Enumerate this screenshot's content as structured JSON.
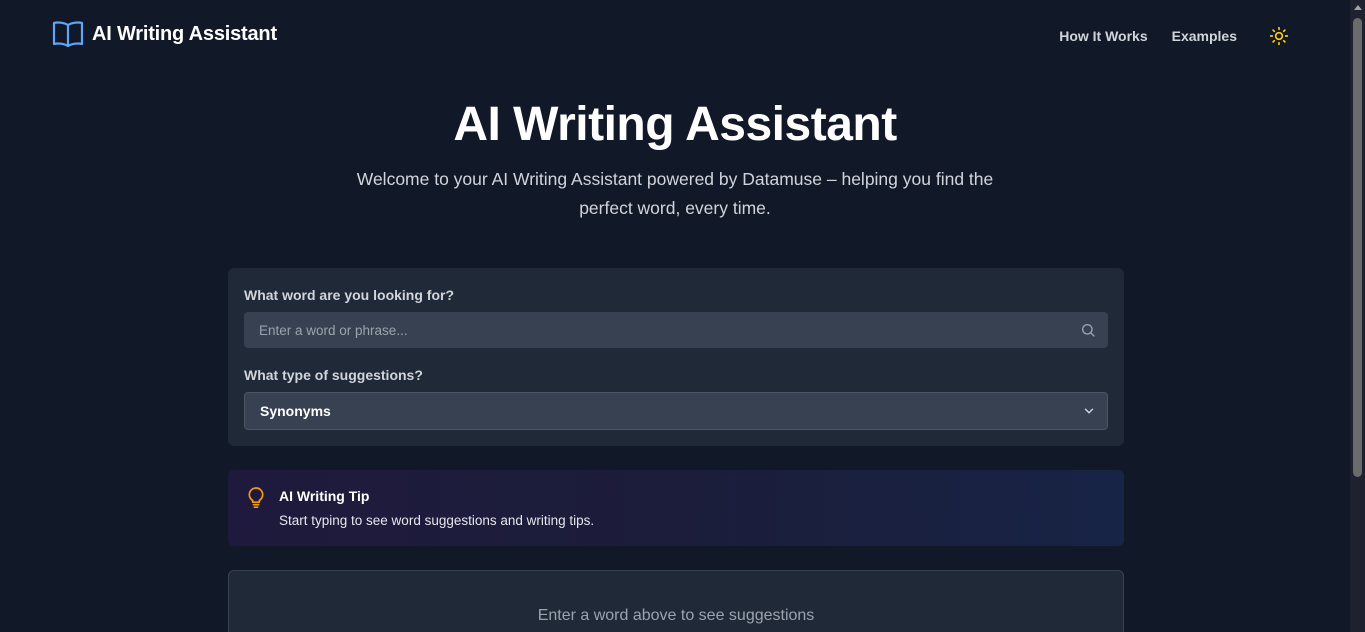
{
  "header": {
    "brand": "AI Writing Assistant",
    "brand_icon": "open-book-icon",
    "nav": [
      "How It Works",
      "Examples"
    ],
    "theme_icon": "sun-icon"
  },
  "hero": {
    "title": "AI Writing Assistant",
    "subtitle": "Welcome to your AI Writing Assistant powered by Datamuse – helping you find the perfect word, every time."
  },
  "search": {
    "word_label": "What word are you looking for?",
    "placeholder": "Enter a word or phrase...",
    "value": "",
    "type_label": "What type of suggestions?",
    "type_selected": "Synonyms"
  },
  "tip": {
    "icon": "lightbulb-icon",
    "title": "AI Writing Tip",
    "text": "Start typing to see word suggestions and writing tips."
  },
  "results": {
    "empty_message": "Enter a word above to see suggestions"
  },
  "colors": {
    "background": "#111827",
    "card": "#1f2937",
    "input": "#374151",
    "accent": "#60a5fa",
    "tip_icon": "#f59e0b",
    "sun": "#facc15"
  }
}
